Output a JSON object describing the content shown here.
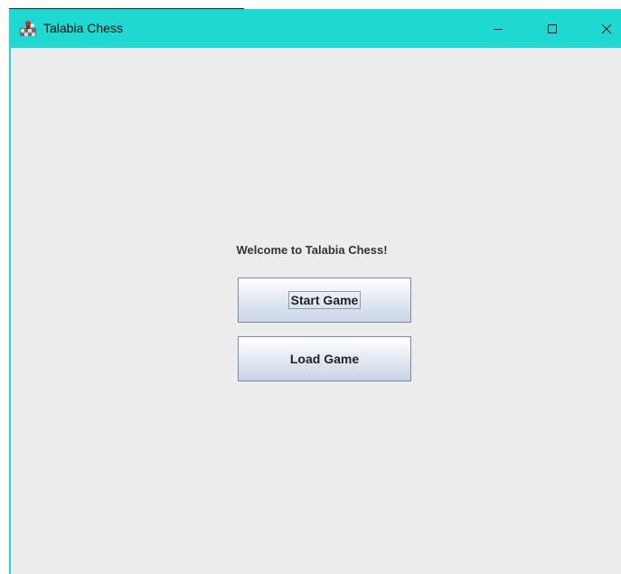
{
  "window": {
    "title": "Talabia Chess",
    "app_icon": "chess-app-icon",
    "controls": {
      "minimize_icon": "minimize-icon",
      "maximize_icon": "maximize-icon",
      "close_icon": "close-icon"
    }
  },
  "main": {
    "welcome_text": "Welcome to Talabia Chess!",
    "start_button_label": "Start Game",
    "load_button_label": "Load Game"
  },
  "colors": {
    "titlebar": "#20d8d2",
    "background": "#ececec",
    "button_border": "#7a8aa6"
  }
}
